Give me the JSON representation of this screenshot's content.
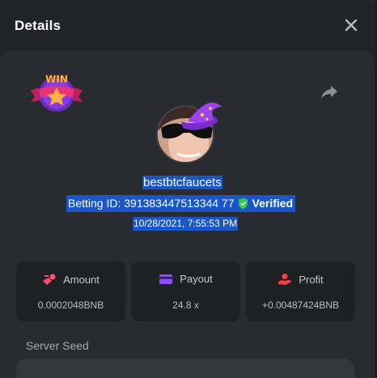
{
  "dialog": {
    "title": "Details",
    "close_icon": "close-icon"
  },
  "badge": {
    "text": "WIN"
  },
  "share_icon": "share-arrow-icon",
  "player": {
    "username": "bestbtcfaucets",
    "betting_id": "Betting ID: 391383447513344 77",
    "verified": "Verified",
    "date": "10/28/2021, 7:55:53 PM"
  },
  "stats": {
    "amount": {
      "label": "Amount",
      "value": "0.0002048BNB",
      "icon": "coins-icon",
      "color": "#ff4d6d"
    },
    "payout": {
      "label": "Payout",
      "value": "24.8 x",
      "icon": "card-icon",
      "color": "#8a4dff"
    },
    "profit": {
      "label": "Profit",
      "value": "+0.00487424BNB",
      "icon": "profit-hand-icon",
      "color": "#ff3d3d"
    }
  },
  "seed": {
    "label": "Server Seed"
  },
  "colors": {
    "accent": "#1a56c8",
    "verified_green": "#2ecc40"
  }
}
